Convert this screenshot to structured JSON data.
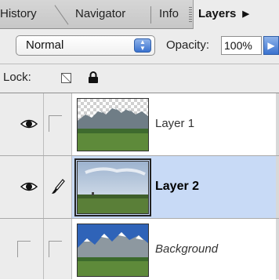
{
  "tabs": {
    "history": "History",
    "navigator": "Navigator",
    "info": "Info",
    "layers": "Layers",
    "layers_arrow": "▶"
  },
  "blend": {
    "mode": "Normal",
    "opacity_label": "Opacity:",
    "opacity_value": "100%"
  },
  "lock": {
    "label": "Lock:"
  },
  "layers": [
    {
      "name": "Layer 1",
      "visible": true,
      "linked": false,
      "selected": false,
      "thumbnail": "mountains-transparent-sky-icon"
    },
    {
      "name": "Layer 2",
      "visible": true,
      "linked": true,
      "selected": true,
      "thumbnail": "field-sky-icon"
    },
    {
      "name": "Background",
      "visible": false,
      "linked": false,
      "selected": false,
      "thumbnail": "mountains-blue-sky-icon"
    }
  ],
  "colors": {
    "selection": "#c8daf6",
    "accent_button": "#3a72cf"
  }
}
